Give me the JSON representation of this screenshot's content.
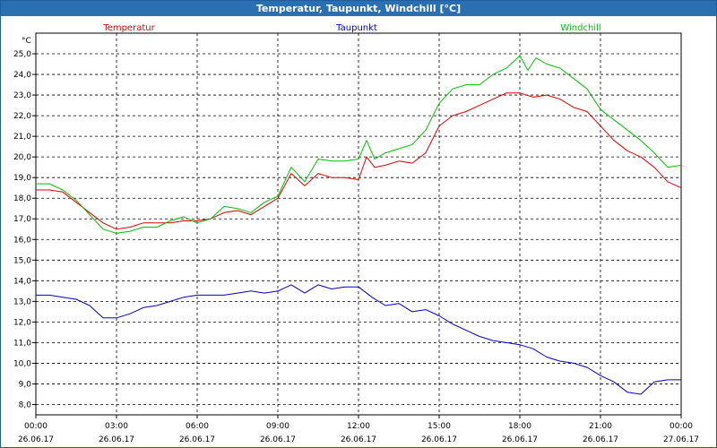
{
  "window": {
    "title": "Temperatur, Taupunkt, Windchill [°C]"
  },
  "chart_data": {
    "type": "line",
    "title": "Temperatur, Taupunkt, Windchill [°C]",
    "ylabel": "°C",
    "ylim": [
      7.5,
      26.0
    ],
    "yticks": [
      "8,0",
      "9,0",
      "10,0",
      "11,0",
      "12,0",
      "13,0",
      "14,0",
      "15,0",
      "16,0",
      "17,0",
      "18,0",
      "19,0",
      "20,0",
      "21,0",
      "22,0",
      "23,0",
      "24,0",
      "25,0"
    ],
    "xlim": [
      0,
      24
    ],
    "xticks": [
      {
        "time": "00:00",
        "date": "26.06.17"
      },
      {
        "time": "03:00",
        "date": "26.06.17"
      },
      {
        "time": "06:00",
        "date": "26.06.17"
      },
      {
        "time": "09:00",
        "date": "26.06.17"
      },
      {
        "time": "12:00",
        "date": "26.06.17"
      },
      {
        "time": "15:00",
        "date": "26.06.17"
      },
      {
        "time": "18:00",
        "date": "26.06.17"
      },
      {
        "time": "21:00",
        "date": "26.06.17"
      },
      {
        "time": "00:00",
        "date": "27.06.17"
      }
    ],
    "grid": true,
    "legend_placement": "top",
    "series": [
      {
        "name": "Temperatur",
        "color": "#e00000",
        "x": [
          0,
          0.5,
          1,
          1.5,
          2,
          2.5,
          3,
          3.5,
          4,
          4.5,
          5,
          5.5,
          6,
          6.5,
          7,
          7.5,
          8,
          8.5,
          9,
          9.5,
          10,
          10.5,
          11,
          11.5,
          12,
          12.3,
          12.6,
          13,
          13.5,
          14,
          14.5,
          15,
          15.5,
          16,
          16.5,
          17,
          17.5,
          18,
          18.5,
          19,
          19.5,
          20,
          20.5,
          21,
          21.5,
          22,
          22.5,
          23,
          23.5,
          24
        ],
        "values": [
          18.4,
          18.4,
          18.3,
          17.8,
          17.3,
          16.8,
          16.5,
          16.6,
          16.8,
          16.8,
          16.8,
          16.9,
          16.9,
          17.0,
          17.3,
          17.4,
          17.2,
          17.6,
          18.0,
          19.2,
          18.6,
          19.2,
          19.0,
          19.0,
          18.9,
          20.0,
          19.5,
          19.6,
          19.8,
          19.7,
          20.2,
          21.5,
          22.0,
          22.2,
          22.5,
          22.8,
          23.1,
          23.1,
          22.9,
          23.0,
          22.8,
          22.4,
          22.2,
          21.5,
          20.8,
          20.3,
          20.0,
          19.5,
          18.8,
          18.5
        ]
      },
      {
        "name": "Taupunkt",
        "color": "#0000c8",
        "x": [
          0,
          0.5,
          1,
          1.5,
          2,
          2.5,
          3,
          3.5,
          4,
          4.5,
          5,
          5.5,
          6,
          6.5,
          7,
          7.5,
          8,
          8.5,
          9,
          9.5,
          10,
          10.5,
          11,
          11.5,
          12,
          12.5,
          13,
          13.5,
          14,
          14.5,
          15,
          15.5,
          16,
          16.5,
          17,
          17.5,
          18,
          18.5,
          19,
          19.5,
          20,
          20.5,
          21,
          21.5,
          22,
          22.5,
          23,
          23.5,
          24
        ],
        "values": [
          13.3,
          13.3,
          13.2,
          13.1,
          12.8,
          12.2,
          12.2,
          12.4,
          12.7,
          12.8,
          13.0,
          13.2,
          13.3,
          13.3,
          13.3,
          13.4,
          13.5,
          13.4,
          13.5,
          13.8,
          13.4,
          13.8,
          13.6,
          13.7,
          13.7,
          13.2,
          12.8,
          12.9,
          12.5,
          12.6,
          12.3,
          11.9,
          11.6,
          11.3,
          11.1,
          11.0,
          10.9,
          10.7,
          10.3,
          10.1,
          10.0,
          9.8,
          9.4,
          9.1,
          8.6,
          8.5,
          9.1,
          9.2,
          9.2
        ]
      },
      {
        "name": "Windchill",
        "color": "#00c000",
        "x": [
          0,
          0.5,
          1,
          1.5,
          2,
          2.5,
          3,
          3.5,
          4,
          4.5,
          5,
          5.5,
          6,
          6.5,
          7,
          7.5,
          8,
          8.5,
          9,
          9.5,
          10,
          10.5,
          11,
          11.5,
          12,
          12.3,
          12.6,
          13,
          13.5,
          14,
          14.5,
          15,
          15.5,
          16,
          16.5,
          17,
          17.5,
          18,
          18.3,
          18.6,
          19,
          19.5,
          20,
          20.5,
          21,
          21.5,
          22,
          22.5,
          23,
          23.5,
          24
        ],
        "values": [
          18.7,
          18.7,
          18.4,
          17.9,
          17.2,
          16.5,
          16.3,
          16.4,
          16.6,
          16.6,
          16.9,
          17.1,
          16.8,
          17.0,
          17.6,
          17.5,
          17.3,
          17.8,
          18.1,
          19.5,
          18.8,
          19.9,
          19.8,
          19.8,
          19.9,
          20.8,
          19.9,
          20.2,
          20.4,
          20.6,
          21.3,
          22.6,
          23.3,
          23.5,
          23.5,
          24.0,
          24.3,
          24.9,
          24.2,
          24.8,
          24.5,
          24.3,
          23.8,
          23.3,
          22.3,
          21.8,
          21.3,
          20.8,
          20.2,
          19.5,
          19.6
        ]
      }
    ]
  }
}
